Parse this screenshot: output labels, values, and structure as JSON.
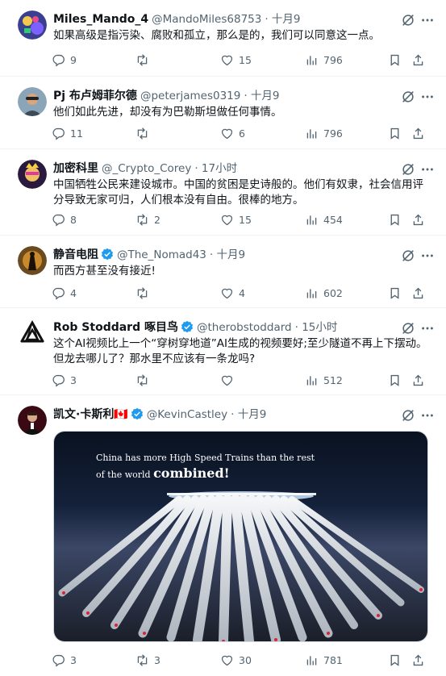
{
  "tweets": [
    {
      "name": "Miles_Mando_4",
      "handle": "@MandoMiles68753",
      "time": "· 十月9",
      "text": "如果高级是指污染、腐败和孤立，那么是的，我们可以同意这一点。",
      "replies": "9",
      "retweets": "",
      "likes": "15",
      "views": "796"
    },
    {
      "name": "Pj 布卢姆菲尔德",
      "handle": "@peterjames0319",
      "time": "· 十月9",
      "text": "他们如此先进，却没有为巴勒斯坦做任何事情。",
      "replies": "11",
      "retweets": "",
      "likes": "6",
      "views": "796"
    },
    {
      "name": "加密科里",
      "handle": "@_Crypto_Corey",
      "time": "· 17小时",
      "text": "中国牺牲公民来建设城市。中国的贫困是史诗般的。他们有奴隶，社会信用评分导致无家可归，人们根本没有自由。很棒的地方。",
      "replies": "8",
      "retweets": "2",
      "likes": "15",
      "views": "454"
    },
    {
      "name": "静音电阻",
      "handle": "@The_Nomad43",
      "time": "· 十月9",
      "text": "而西方甚至没有接近!",
      "replies": "4",
      "retweets": "",
      "likes": "4",
      "views": "602"
    },
    {
      "name": "Rob Stoddard 啄目鸟",
      "handle": "@therobstoddard",
      "time": "· 15小时",
      "text": "这个AI视频比上一个“穿树穿地道”AI生成的视频要好;至少隧道不再上下摆动。但龙去哪儿了？那水里不应该有一条龙吗?",
      "replies": "3",
      "retweets": "",
      "likes": "",
      "views": "512"
    },
    {
      "name": "凯文·卡斯利🇨🇦",
      "handle": "@KevinCastley",
      "time": "· 十月9",
      "text": "",
      "replies": "3",
      "retweets": "3",
      "likes": "30",
      "views": "781",
      "media_caption_line1": "China has more High Speed Trains than the rest",
      "media_caption_line2_prefix": "of the world ",
      "media_caption_line2_bold": "combined!"
    }
  ],
  "colors": {
    "text": "#0f1419",
    "muted": "#536471",
    "verified": "#1d9bf0",
    "divider": "#eff3f4"
  },
  "icons": [
    "reply-icon",
    "retweet-icon",
    "like-icon",
    "views-icon",
    "bookmark-icon",
    "share-icon",
    "grok-icon",
    "more-icon",
    "verified-badge-icon"
  ]
}
